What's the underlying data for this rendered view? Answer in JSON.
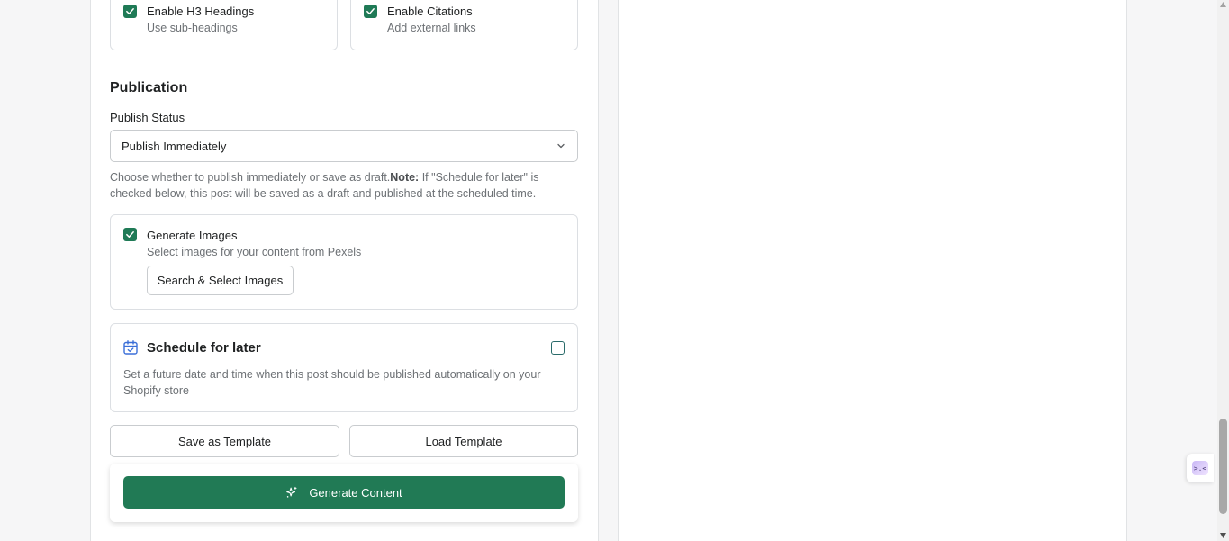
{
  "options": {
    "h3": {
      "label": "Enable H3 Headings",
      "help": "Use sub-headings",
      "checked": true
    },
    "citations": {
      "label": "Enable Citations",
      "help": "Add external links",
      "checked": true
    }
  },
  "publication": {
    "section_title": "Publication",
    "status_label": "Publish Status",
    "status_value": "Publish Immediately",
    "help_prefix": "Choose whether to publish immediately or save as draft.",
    "help_note_label": "Note:",
    "help_suffix": " If \"Schedule for later\" is checked below, this post will be saved as a draft and published at the scheduled time."
  },
  "images": {
    "label": "Generate Images",
    "help": "Select images for your content from Pexels",
    "checked": true,
    "button_label": "Search & Select Images"
  },
  "schedule": {
    "title": "Schedule for later",
    "description": "Set a future date and time when this post should be published automatically on your Shopify store",
    "checked": false
  },
  "templates": {
    "save_label": "Save as Template",
    "load_label": "Load Template"
  },
  "generate": {
    "label": "Generate Content"
  },
  "widget": {
    "glyph": ">.<"
  },
  "colors": {
    "accent": "#217a55",
    "checkbox": "#1f7a56"
  },
  "scroll": {
    "position_fraction": 0.82
  }
}
